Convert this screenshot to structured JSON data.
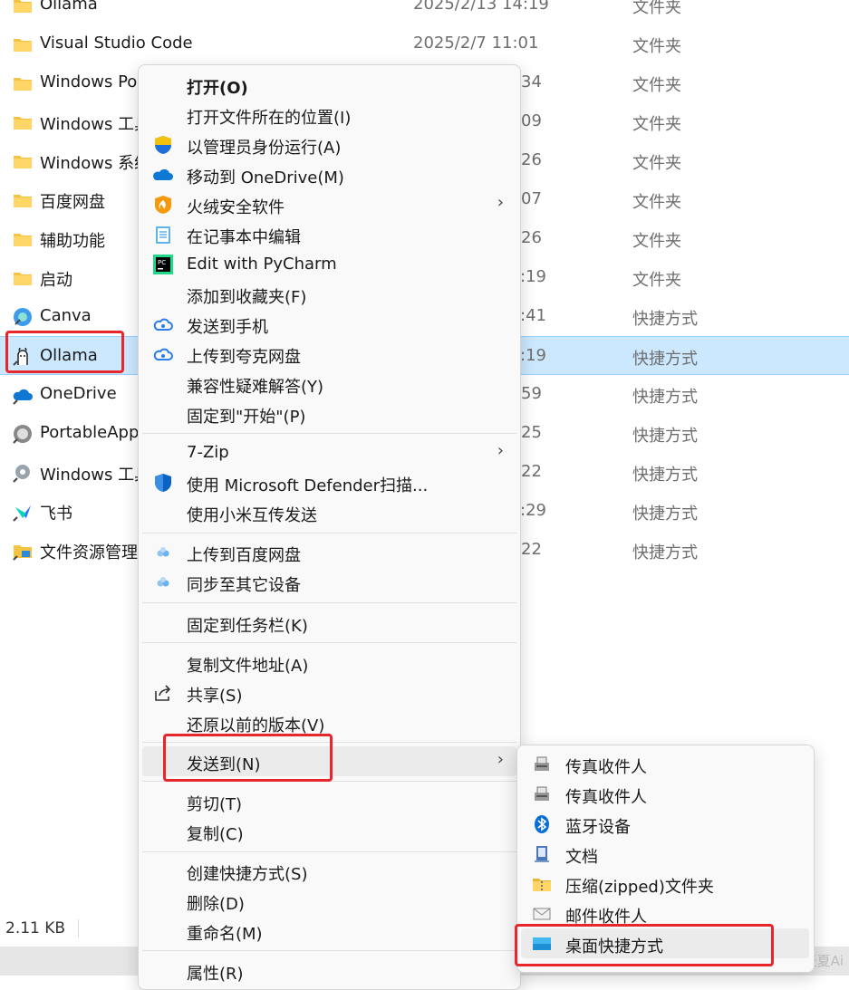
{
  "file_list": [
    {
      "name": "Ollama",
      "date": "2025/2/13 14:19",
      "type": "文件夹",
      "icon": "folder-icon"
    },
    {
      "name": "Visual Studio Code",
      "date": "2025/2/7 11:01",
      "type": "文件夹",
      "icon": "folder-icon"
    },
    {
      "name": "Windows PowerShell",
      "date": "34",
      "type": "文件夹",
      "icon": "folder-icon"
    },
    {
      "name": "Windows 工具",
      "date": "09",
      "type": "文件夹",
      "icon": "folder-icon"
    },
    {
      "name": "Windows 系统",
      "date": "26",
      "type": "文件夹",
      "icon": "folder-icon"
    },
    {
      "name": "百度网盘",
      "date": "07",
      "type": "文件夹",
      "icon": "folder-icon"
    },
    {
      "name": "辅助功能",
      "date": "26",
      "type": "文件夹",
      "icon": "folder-icon"
    },
    {
      "name": "启动",
      "date": ":19",
      "type": "文件夹",
      "icon": "folder-icon"
    },
    {
      "name": "Canva",
      "date": ":41",
      "type": "快捷方式",
      "icon": "canva-icon"
    },
    {
      "name": "Ollama",
      "date": ":19",
      "type": "快捷方式",
      "icon": "ollama-llama-icon"
    },
    {
      "name": "OneDrive",
      "date": "59",
      "type": "快捷方式",
      "icon": "onedrive-icon"
    },
    {
      "name": "PortableApps",
      "date": "25",
      "type": "快捷方式",
      "icon": "portableapps-icon"
    },
    {
      "name": "Windows 工具",
      "date": "22",
      "type": "快捷方式",
      "icon": "windows-tools-icon"
    },
    {
      "name": "飞书",
      "date": ":29",
      "type": "快捷方式",
      "icon": "feishu-icon"
    },
    {
      "name": "文件资源管理器",
      "date": "22",
      "type": "快捷方式",
      "icon": "file-explorer-icon"
    }
  ],
  "status": {
    "size": "2.11 KB"
  },
  "context_menu": {
    "items": [
      {
        "label": "打开(O)",
        "icon": "",
        "bold": true
      },
      {
        "label": "打开文件所在的位置(I)",
        "icon": ""
      },
      {
        "label": "以管理员身份运行(A)",
        "icon": "uac-shield-icon"
      },
      {
        "label": "移动到 OneDrive(M)",
        "icon": "onedrive-cloud-icon"
      },
      {
        "label": "火绒安全软件",
        "icon": "huorong-icon",
        "submenu": true
      },
      {
        "label": "在记事本中编辑",
        "icon": "notepad-icon"
      },
      {
        "label": "Edit with PyCharm",
        "icon": "pycharm-icon"
      },
      {
        "label": "添加到收藏夹(F)",
        "icon": ""
      },
      {
        "label": "发送到手机",
        "icon": "quark-cloud-icon"
      },
      {
        "label": "上传到夸克网盘",
        "icon": "quark-cloud-icon"
      },
      {
        "label": "兼容性疑难解答(Y)",
        "icon": ""
      },
      {
        "label": "固定到\"开始\"(P)",
        "icon": ""
      },
      {
        "label": "7-Zip",
        "icon": "",
        "submenu": true
      },
      {
        "label": "使用 Microsoft Defender扫描...",
        "icon": "defender-shield-icon"
      },
      {
        "label": "使用小米互传发送",
        "icon": ""
      },
      {
        "label": "上传到百度网盘",
        "icon": "baidu-netdisk-icon"
      },
      {
        "label": "同步至其它设备",
        "icon": "baidu-netdisk-icon"
      },
      {
        "label": "固定到任务栏(K)",
        "icon": ""
      },
      {
        "label": "复制文件地址(A)",
        "icon": ""
      },
      {
        "label": "共享(S)",
        "icon": "share-icon"
      },
      {
        "label": "还原以前的版本(V)",
        "icon": ""
      },
      {
        "label": "发送到(N)",
        "icon": "",
        "submenu": true
      },
      {
        "label": "剪切(T)",
        "icon": ""
      },
      {
        "label": "复制(C)",
        "icon": ""
      },
      {
        "label": "创建快捷方式(S)",
        "icon": ""
      },
      {
        "label": "删除(D)",
        "icon": ""
      },
      {
        "label": "重命名(M)",
        "icon": ""
      },
      {
        "label": "属性(R)",
        "icon": ""
      }
    ]
  },
  "send_to_menu": {
    "items": [
      {
        "label": "传真收件人",
        "icon": "fax-icon"
      },
      {
        "label": "传真收件人",
        "icon": "fax-icon"
      },
      {
        "label": "蓝牙设备",
        "icon": "bluetooth-icon"
      },
      {
        "label": "文档",
        "icon": "documents-icon"
      },
      {
        "label": "压缩(zipped)文件夹",
        "icon": "zip-folder-icon"
      },
      {
        "label": "邮件收件人",
        "icon": "mail-icon"
      },
      {
        "label": "桌面快捷方式",
        "icon": "desktop-icon"
      }
    ]
  },
  "watermark": "CSDN @天夏Ai",
  "colors": {
    "highlight": "#e8262d",
    "selection": "#cce8ff",
    "folder": "#f5c342"
  }
}
